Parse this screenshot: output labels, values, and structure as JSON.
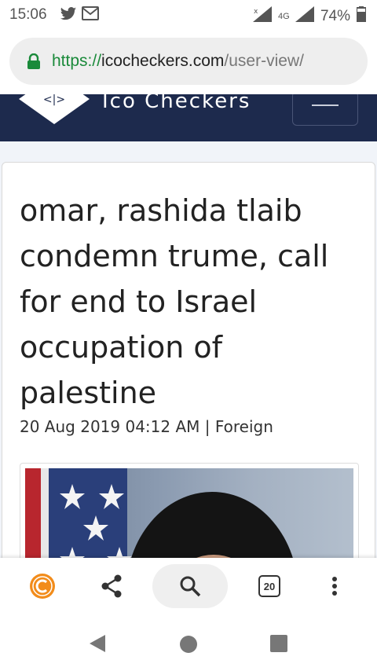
{
  "status_bar": {
    "time": "15:06",
    "battery": "74%",
    "network": "4G",
    "icons": [
      "twitter-icon",
      "gmail-icon",
      "signal-x-icon",
      "signal-icon",
      "battery-icon"
    ]
  },
  "url_bar": {
    "scheme": "https://",
    "host": "icocheckers.com",
    "path": "/user-view/"
  },
  "site": {
    "logo_text": "Ico Checkers",
    "logo_glyph": "<|>",
    "brand_color": "#1d2a4d"
  },
  "article": {
    "headline": "omar, rashida tlaib condemn trume, call for end to Israel occupation of palestine",
    "meta": "20 Aug 2019 04:12 AM | Foreign"
  },
  "bottom_bar": {
    "tab_count": "20",
    "icons": [
      "c-badge-icon",
      "share-icon",
      "search-icon",
      "tabs-icon",
      "more-vert-icon"
    ]
  },
  "nav_bar": {
    "icons": [
      "back-icon",
      "home-icon",
      "recents-icon"
    ]
  }
}
